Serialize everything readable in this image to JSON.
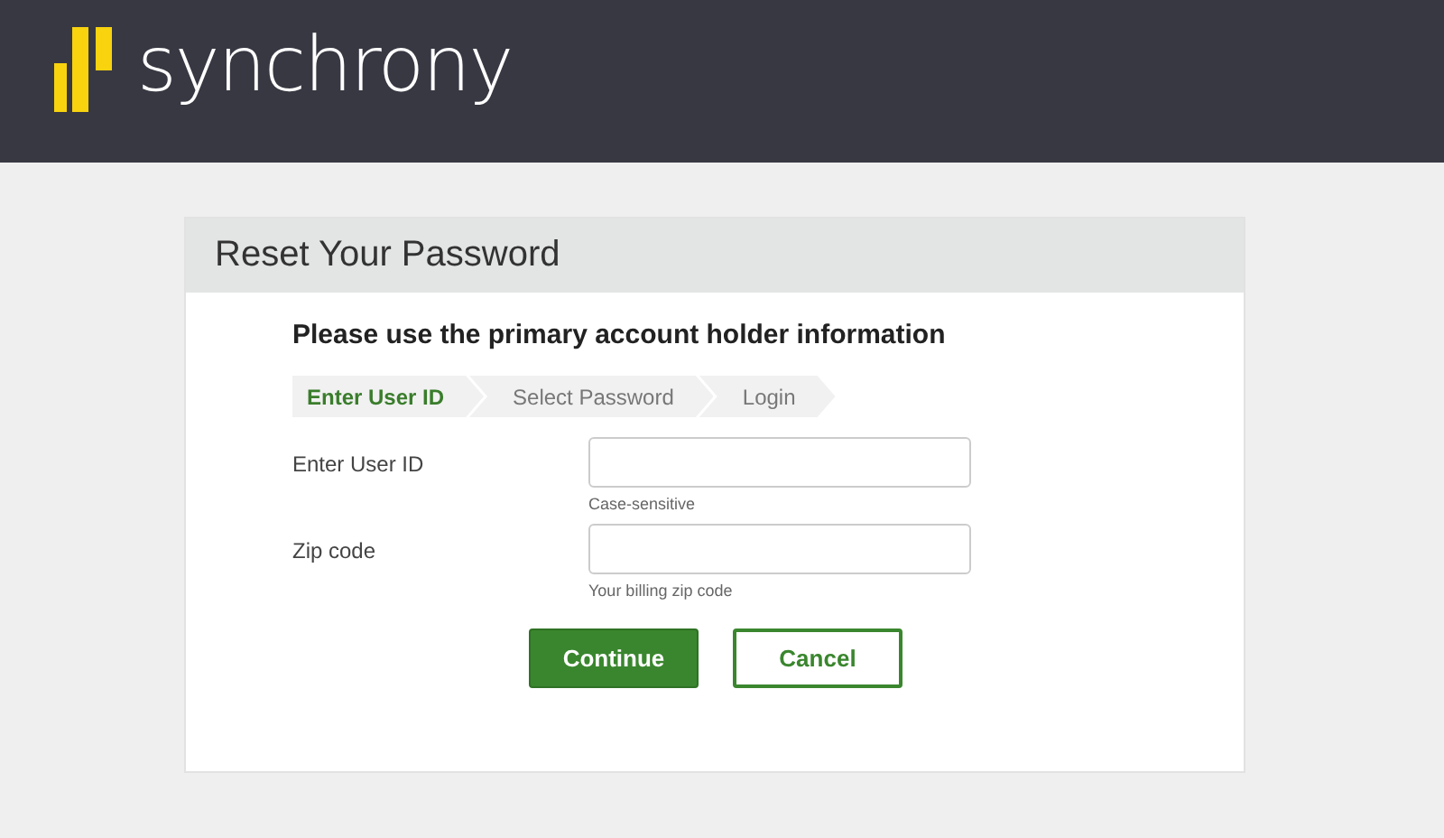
{
  "header": {
    "logo_text": "synchrony"
  },
  "card": {
    "title": "Reset Your Password",
    "heading": "Please use the primary account holder information"
  },
  "steps": [
    {
      "label": "Enter User ID",
      "selected": true
    },
    {
      "label": "Select Password",
      "selected": false
    },
    {
      "label": "Login",
      "selected": false
    }
  ],
  "fields": [
    {
      "label": "Enter User ID",
      "hint": "Case-sensitive"
    },
    {
      "label": "Zip code",
      "hint": "Your billing zip code"
    }
  ],
  "buttons": [
    {
      "label": "Continue",
      "kind": "primary"
    },
    {
      "label": "Cancel",
      "kind": "secondary"
    }
  ]
}
